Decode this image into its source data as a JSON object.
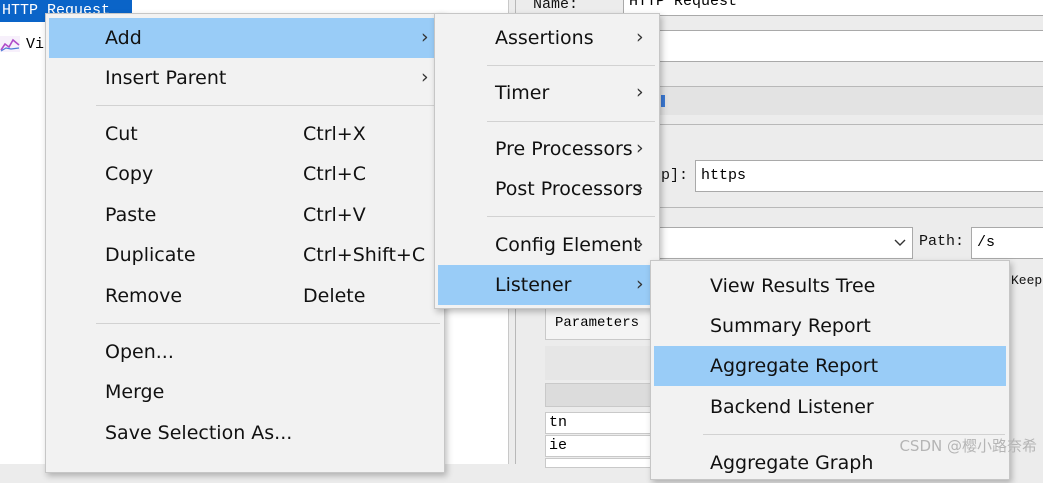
{
  "tree": {
    "selected_label": "HTTP Request",
    "child_label": "Vi"
  },
  "form": {
    "name_label": "Name:",
    "name_value": "HTTP Request",
    "protocol_label_partial": "p]:",
    "protocol_value": "https",
    "path_label": "Path:",
    "path_value": "/s",
    "keep_partial": "Keep",
    "parameters_tab": "Parameters",
    "rows": [
      "tn",
      "ie"
    ]
  },
  "context_menu": {
    "items": [
      {
        "label": "Add",
        "has_submenu": true
      },
      {
        "label": "Insert Parent",
        "has_submenu": true
      },
      {
        "label": "Cut",
        "shortcut": "Ctrl+X"
      },
      {
        "label": "Copy",
        "shortcut": "Ctrl+C"
      },
      {
        "label": "Paste",
        "shortcut": "Ctrl+V"
      },
      {
        "label": "Duplicate",
        "shortcut": "Ctrl+Shift+C"
      },
      {
        "label": "Remove",
        "shortcut": "Delete"
      },
      {
        "label": "Open..."
      },
      {
        "label": "Merge"
      },
      {
        "label": "Save Selection As..."
      }
    ]
  },
  "add_submenu": {
    "items": [
      {
        "label": "Assertions"
      },
      {
        "label": "Timer"
      },
      {
        "label": "Pre Processors"
      },
      {
        "label": "Post Processors"
      },
      {
        "label": "Config Element"
      },
      {
        "label": "Listener"
      }
    ]
  },
  "listener_submenu": {
    "items": [
      {
        "label": "View Results Tree"
      },
      {
        "label": "Summary Report"
      },
      {
        "label": "Aggregate Report"
      },
      {
        "label": "Backend Listener"
      },
      {
        "label": "Aggregate Graph"
      }
    ]
  },
  "chevron_glyph": "›",
  "watermark": "CSDN @樱小路奈希",
  "colors": {
    "highlight": "#99ccf7",
    "tree_selection": "#0a64c8",
    "menu_bg": "#f2f2f2"
  }
}
